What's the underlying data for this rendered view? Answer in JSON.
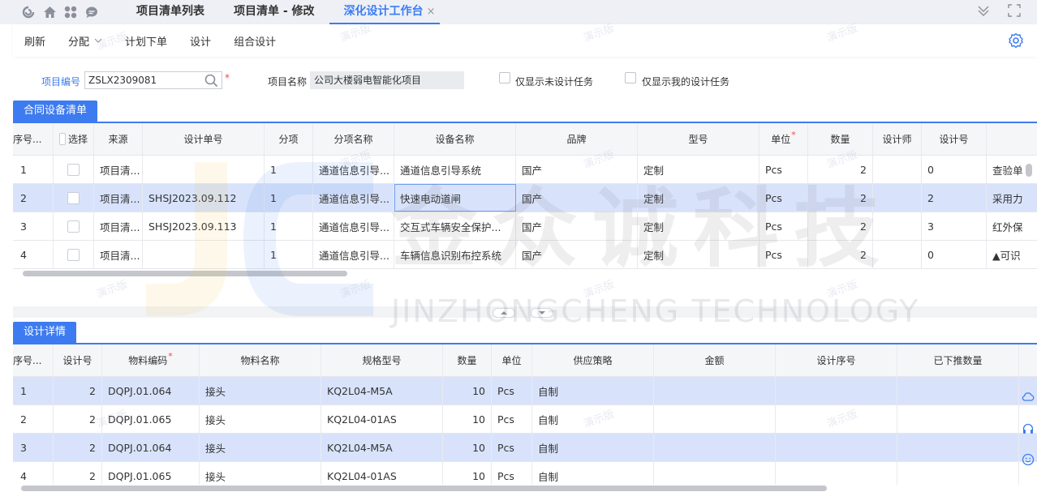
{
  "tabs": [
    {
      "label": "项目清单列表"
    },
    {
      "label": "项目清单 - 修改"
    },
    {
      "label": "深化设计工作台"
    }
  ],
  "tab_close_glyph": "×",
  "toolbar": {
    "refresh": "刷新",
    "assign": "分配",
    "plan_order": "计划下单",
    "design": "设计",
    "combo_design": "组合设计"
  },
  "form": {
    "project_no_label": "项目编号",
    "project_no_value": "ZSLX2309081",
    "required_mark": "*",
    "project_name_label": "项目名称",
    "project_name_value": "公司大楼弱电智能化项目",
    "only_undesigned": "仅显示未设计任务",
    "only_mine": "仅显示我的设计任务"
  },
  "contract_section": {
    "title": "合同设备清单",
    "select_label": "选择",
    "columns": [
      "序号...",
      "选择",
      "来源",
      "设计单号",
      "分项",
      "分项名称",
      "设备名称",
      "品牌",
      "型号",
      "单位",
      "数量",
      "设计师",
      "设计号",
      ""
    ],
    "rows": [
      {
        "seq": "1",
        "source": "项目清...",
        "design_no": "",
        "item": "1",
        "item_name": "通道信息引导...",
        "device": "通道信息引导系统",
        "brand": "国产",
        "model": "定制",
        "unit": "Pcs",
        "qty": "2",
        "designer": "",
        "design_num": "0",
        "extra": "查验单"
      },
      {
        "seq": "2",
        "source": "项目清...",
        "design_no": "SHSJ2023.09.112",
        "item": "1",
        "item_name": "通道信息引导...",
        "device": "快速电动道闸",
        "brand": "国产",
        "model": "定制",
        "unit": "Pcs",
        "qty": "2",
        "designer": "",
        "design_num": "2",
        "extra": "采用力"
      },
      {
        "seq": "3",
        "source": "项目清...",
        "design_no": "SHSJ2023.09.113",
        "item": "1",
        "item_name": "通道信息引导...",
        "device": "交互式车辆安全保护...",
        "brand": "国产",
        "model": "定制",
        "unit": "Pcs",
        "qty": "2",
        "designer": "",
        "design_num": "3",
        "extra": "红外保"
      },
      {
        "seq": "4",
        "source": "项目清...",
        "design_no": "",
        "item": "1",
        "item_name": "通道信息引导...",
        "device": "车辆信息识别布控系统",
        "brand": "国产",
        "model": "定制",
        "unit": "Pcs",
        "qty": "2",
        "designer": "",
        "design_num": "0",
        "extra": "▲可识"
      }
    ]
  },
  "detail_section": {
    "title": "设计详情",
    "columns": [
      "序号...",
      "设计号",
      "物料编码",
      "物料名称",
      "规格型号",
      "数量",
      "单位",
      "供应策略",
      "金额",
      "设计序号",
      "已下推数量"
    ],
    "rows": [
      {
        "seq": "1",
        "design_num": "2",
        "code": "DQPJ.01.064",
        "name": "接头",
        "spec": "KQ2L04-M5A",
        "qty": "10",
        "unit": "Pcs",
        "strategy": "自制",
        "amount": "",
        "design_seq": "",
        "pushed": ""
      },
      {
        "seq": "2",
        "design_num": "2",
        "code": "DQPJ.01.065",
        "name": "接头",
        "spec": "KQ2L04-01AS",
        "qty": "10",
        "unit": "Pcs",
        "strategy": "自制",
        "amount": "",
        "design_seq": "",
        "pushed": ""
      },
      {
        "seq": "3",
        "design_num": "2",
        "code": "DQPJ.01.064",
        "name": "接头",
        "spec": "KQ2L04-M5A",
        "qty": "10",
        "unit": "Pcs",
        "strategy": "自制",
        "amount": "",
        "design_seq": "",
        "pushed": ""
      },
      {
        "seq": "4",
        "design_num": "2",
        "code": "DQPJ.01.065",
        "name": "接头",
        "spec": "KQ2L04-01AS",
        "qty": "10",
        "unit": "Pcs",
        "strategy": "自制",
        "amount": "",
        "design_seq": "",
        "pushed": ""
      }
    ]
  },
  "watermark": {
    "demo": "演示版",
    "company_cn": "金众诚科技",
    "company_en": "JINZHONGCHENG TECHNOLOGY"
  },
  "colors": {
    "accent": "#3d7bf0",
    "selected_row": "#d8e3fb",
    "required": "#f04a4a"
  },
  "icons": [
    "refresh-icon",
    "home-icon",
    "apps-grid-icon",
    "chat-icon",
    "chevron-down-icon",
    "fullscreen-icon",
    "gear-icon",
    "search-icon",
    "cloud-icon",
    "headset-icon",
    "smile-icon"
  ]
}
